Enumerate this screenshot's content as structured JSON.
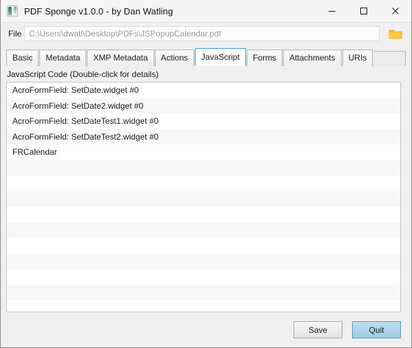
{
  "window": {
    "title": "PDF Sponge v1.0.0 - by Dan Watling",
    "icon": "app-window-icon",
    "controls": {
      "minimize": "minimize-icon",
      "maximize": "maximize-icon",
      "close": "close-icon"
    }
  },
  "file_row": {
    "label": "File",
    "path_value": "C:\\Users\\dwatl\\Desktop\\PDFs\\JSPopupCalendar.pdf",
    "placeholder": "C:\\Users\\dwatl\\Desktop\\PDFs\\JSPopupCalendar.pdf",
    "browse_icon": "folder-icon"
  },
  "tabs": [
    {
      "label": "Basic",
      "selected": false
    },
    {
      "label": "Metadata",
      "selected": false
    },
    {
      "label": "XMP Metadata",
      "selected": false
    },
    {
      "label": "Actions",
      "selected": false
    },
    {
      "label": "JavaScript",
      "selected": true
    },
    {
      "label": "Forms",
      "selected": false
    },
    {
      "label": "Attachments",
      "selected": false
    },
    {
      "label": "URIs",
      "selected": false
    }
  ],
  "content": {
    "section_label": "JavaScript Code (Double-click for details)",
    "items": [
      "AcroFormField: SetDate.widget #0",
      "AcroFormField: SetDate2.widget #0",
      "AcroFormField: SetDateTest1.widget #0",
      "AcroFormField: SetDateTest2.widget #0",
      "FRCalendar"
    ],
    "empty_row_count": 9
  },
  "footer": {
    "save_label": "Save",
    "quit_label": "Quit"
  },
  "colors": {
    "accent_tab_border": "#3c9bd8",
    "primary_button_fill": "#9ecde4",
    "primary_button_border": "#4ba3cd",
    "folder_icon": "#fcc93f",
    "window_background": "#f0f0f0",
    "list_background": "#ffffff",
    "list_alt_row": "#f7f7f7"
  }
}
